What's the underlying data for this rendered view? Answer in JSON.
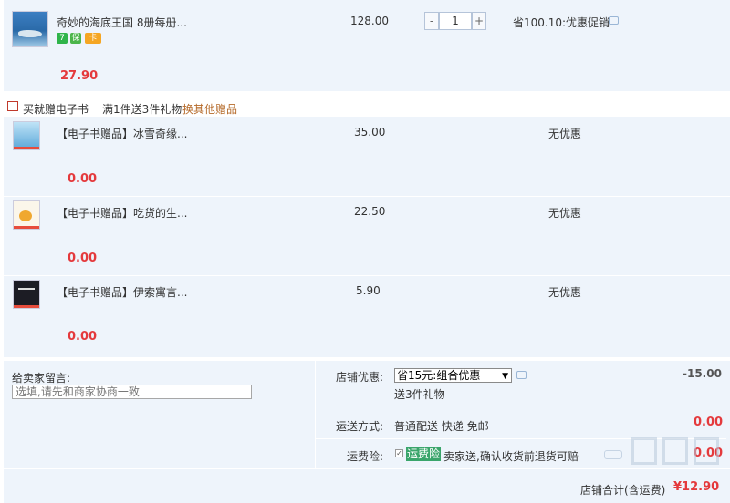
{
  "main_item": {
    "title": "奇妙的海底王国 8册每册...",
    "price": "128.00",
    "quantity": "1",
    "qty_minus": "-",
    "qty_plus": "+",
    "promo": "省100.10:优惠促销",
    "subtotal": "27.90",
    "badges": [
      {
        "label": "7",
        "color": "#2fb44a"
      },
      {
        "label": "保",
        "color": "#4bb54a"
      },
      {
        "label": "卡",
        "color": "#f5a623"
      }
    ]
  },
  "gift_header": {
    "label": "买就赠电子书",
    "rule": "满1件送3件礼物",
    "change_link": "换其他赠品"
  },
  "gifts": [
    {
      "title": "【电子书赠品】冰雪奇缘...",
      "price": "35.00",
      "promo": "无优惠",
      "subtotal": "0.00"
    },
    {
      "title": "【电子书赠品】吃货的生...",
      "price": "22.50",
      "promo": "无优惠",
      "subtotal": "0.00"
    },
    {
      "title": "【电子书赠品】伊索寓言...",
      "price": "5.90",
      "promo": "无优惠",
      "subtotal": "0.00"
    }
  ],
  "footer": {
    "message_label": "给卖家留言:",
    "message_placeholder": "选填,请先和商家协商一致",
    "shop_discount_label": "店铺优惠:",
    "shop_discount_selected": "省15元:组合优惠",
    "shop_discount_gift": "送3件礼物",
    "shop_discount_amount": "-15.00",
    "shipping_label": "运送方式:",
    "shipping_value": "普通配送 快递 免邮",
    "shipping_amount": "0.00",
    "insurance_label": "运费险:",
    "insurance_tag": "运费险",
    "insurance_desc": "卖家送,确认收货前退货可赔",
    "insurance_amount": "0.00",
    "total_label": "店铺合计(含运费)",
    "total_amount": "¥12.90"
  },
  "colors": {
    "price_red": "#e4393c",
    "panel_blue": "#eef4fb",
    "insurance_green": "#3aa56b"
  }
}
